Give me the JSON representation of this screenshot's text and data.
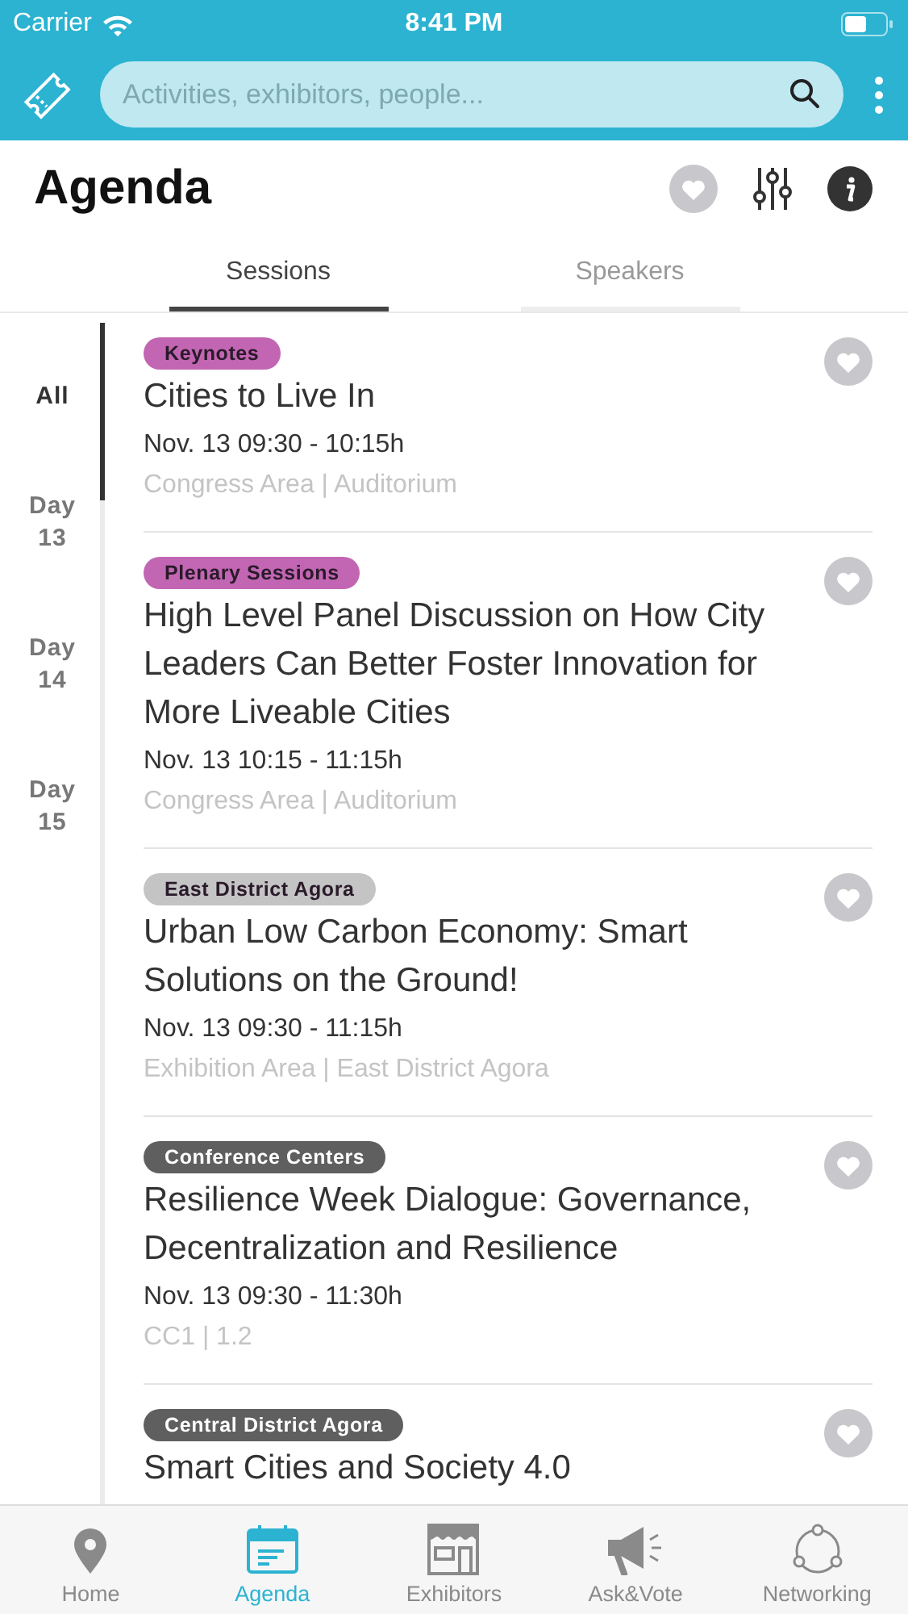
{
  "status_bar": {
    "carrier": "Carrier",
    "time": "8:41 PM"
  },
  "search": {
    "placeholder": "Activities, exhibitors, people..."
  },
  "title": "Agenda",
  "tabs": [
    {
      "label": "Sessions",
      "selected": true
    },
    {
      "label": "Speakers",
      "selected": false
    }
  ],
  "days": [
    {
      "label": "All",
      "selected": true
    },
    {
      "label": "Day 13",
      "selected": false
    },
    {
      "label": "Day 14",
      "selected": false
    },
    {
      "label": "Day 15",
      "selected": false
    }
  ],
  "sessions": [
    {
      "tag": "Keynotes",
      "color": "#c266b3",
      "title": "Cities to Live In",
      "time": "Nov. 13 09:30 - 10:15h",
      "location": "Congress Area | Auditorium",
      "favorite": false
    },
    {
      "tag": "Plenary Sessions",
      "color": "#c266b3",
      "title": "High Level Panel Discussion on How City Leaders Can Better Foster Innovation for More Liveable Cities",
      "time": "Nov. 13 10:15 - 11:15h",
      "location": "Congress Area | Auditorium",
      "favorite": false
    },
    {
      "tag": "East District Agora",
      "color": "#c4c4c4",
      "title": "Urban Low Carbon Economy: Smart Solutions on the Ground!",
      "time": "Nov. 13 09:30 - 11:15h",
      "location": "Exhibition Area | East District Agora",
      "favorite": false
    },
    {
      "tag": "Conference Centers",
      "color": "#5f5f5f",
      "title": "Resilience Week Dialogue: Governance, Decentralization and Resilience",
      "time": "Nov. 13 09:30 - 11:30h",
      "location": "CC1 | 1.2",
      "favorite": false
    },
    {
      "tag": "Central District Agora",
      "color": "#5f5f5f",
      "title": "Smart Cities and Society 4.0",
      "favorite": false
    }
  ],
  "nav": [
    {
      "label": "Home",
      "kind": "pin",
      "selected": false
    },
    {
      "label": "Agenda",
      "kind": "calendar",
      "selected": true
    },
    {
      "label": "Exhibitors",
      "kind": "store",
      "selected": false
    },
    {
      "label": "Ask&Vote",
      "kind": "megaphone",
      "selected": false
    },
    {
      "label": "Networking",
      "kind": "network",
      "selected": false
    }
  ]
}
